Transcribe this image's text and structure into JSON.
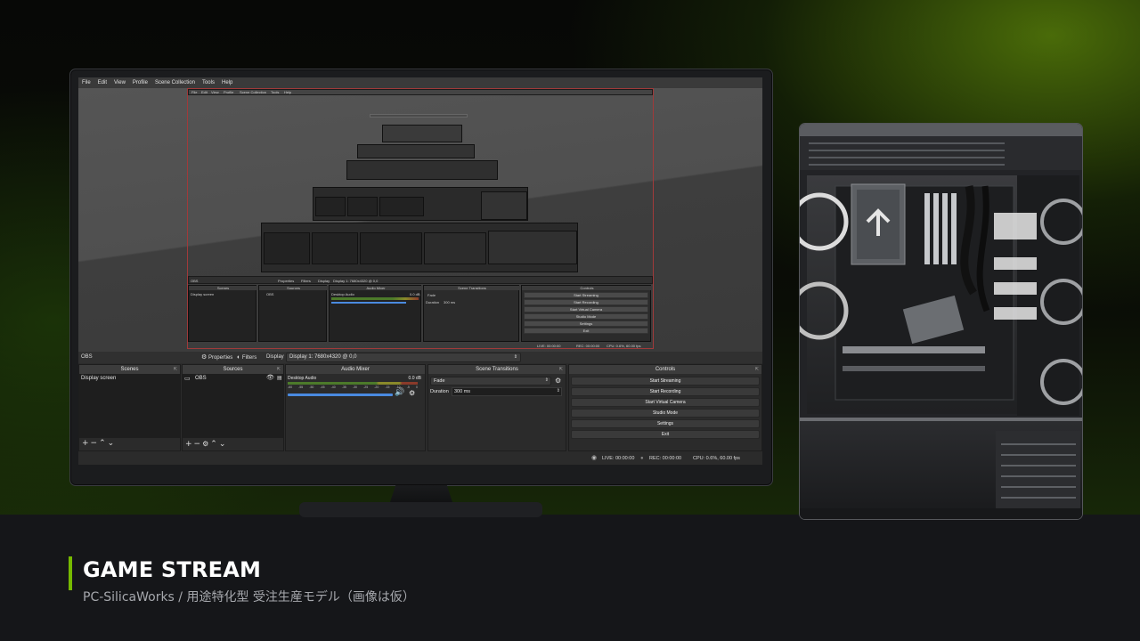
{
  "menu": [
    "File",
    "Edit",
    "View",
    "Profile",
    "Scene Collection",
    "Tools",
    "Help"
  ],
  "source_bar": {
    "name": "OBS",
    "properties": "Properties",
    "filters": "Filters",
    "display_label": "Display",
    "display_value": "Display 1: 7680x4320 @ 0,0"
  },
  "nested_preview": {
    "menu": [
      "File",
      "Edit",
      "View",
      "Profile",
      "Scene Collection",
      "Tools",
      "Help"
    ],
    "source_bar": {
      "name": "OBS",
      "properties": "Properties",
      "filters": "Filters",
      "display_label": "Display",
      "display_value": "Display 1: 7680x4320 @ 0,0"
    },
    "scenes_title": "Scenes",
    "scene": "Display screen",
    "sources_title": "Sources",
    "source": "OBS",
    "mixer_title": "Audio Mixer",
    "mixer_channel": "Desktop Audio",
    "mixer_db": "0.0 dB",
    "transitions_title": "Scene Transitions",
    "transition": "Fade",
    "duration_label": "Duration",
    "duration": "300 ms",
    "controls_title": "Controls",
    "controls": [
      "Start Streaming",
      "Start Recording",
      "Start Virtual Camera",
      "Studio Mode",
      "Settings",
      "Exit"
    ],
    "status": {
      "live": "LIVE: 00:00:00",
      "rec": "REC: 00:00:00",
      "cpu": "CPU: 0.6%, 60.00 fps"
    }
  },
  "docks": {
    "scenes": {
      "title": "Scenes",
      "items": [
        "Display screen"
      ]
    },
    "sources": {
      "title": "Sources",
      "items": [
        "OBS"
      ]
    },
    "mixer": {
      "title": "Audio Mixer",
      "channel": "Desktop Audio",
      "db": "0.0 dB",
      "ticks": [
        "-60",
        "-55",
        "-50",
        "-45",
        "-40",
        "-35",
        "-30",
        "-25",
        "-20",
        "-15",
        "-10",
        "-5",
        "0"
      ]
    },
    "transitions": {
      "title": "Scene Transitions",
      "transition": "Fade",
      "duration_label": "Duration",
      "duration": "300 ms"
    },
    "controls": {
      "title": "Controls",
      "buttons": [
        "Start Streaming",
        "Start Recording",
        "Start Virtual Camera",
        "Studio Mode",
        "Settings",
        "Exit"
      ]
    }
  },
  "status": {
    "live": "LIVE: 00:00:00",
    "rec": "REC: 00:00:00",
    "cpu": "CPU: 0.6%, 60.00 fps"
  },
  "caption": {
    "title": "GAME STREAM",
    "subtitle": "PC-SilicaWorks  /  用途特化型 受注生産モデル（画像は仮）"
  },
  "colors": {
    "accent": "#76b900",
    "background": "#141416",
    "red_outline": "#a03a3a"
  }
}
